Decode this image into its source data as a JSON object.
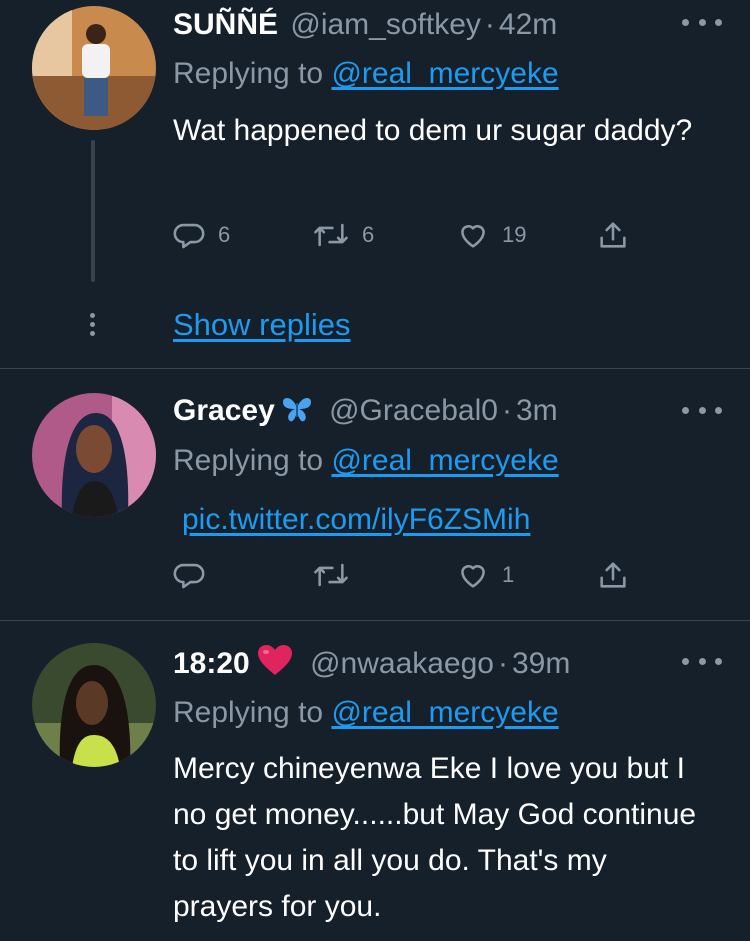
{
  "tweets": [
    {
      "name": "SUÑÑÉ",
      "handle": "@iam_softkey",
      "separator": "·",
      "time": "42m",
      "replying_prefix": "Replying to",
      "replying_to": "@real_mercyeke",
      "text": "Wat happened to dem ur sugar daddy?",
      "counts": {
        "reply": "6",
        "retweet": "6",
        "like": "19"
      }
    },
    {
      "name": "Gracey",
      "emoji": "butterfly",
      "handle": "@Gracebal0",
      "separator": "·",
      "time": "3m",
      "replying_prefix": "Replying to",
      "replying_to": "@real_mercyeke",
      "link": "pic.twitter.com/ilyF6ZSMih",
      "counts": {
        "reply": "",
        "retweet": "",
        "like": "1"
      }
    },
    {
      "name": "18:20",
      "emoji": "red-heart",
      "handle": "@nwaakaego",
      "separator": "·",
      "time": "39m",
      "replying_prefix": "Replying to",
      "replying_to": "@real_mercyeke",
      "text": "Mercy chineyenwa Eke I love you but I no get money......but May God continue to lift you in all you do. That's my prayers for you."
    }
  ],
  "thread": {
    "show_replies": "Show replies"
  },
  "colors": {
    "background": "#15202b",
    "secondary_text": "#8b98a5",
    "link": "#1d9bf0",
    "divider": "#38444d",
    "heart": "#e0245e",
    "butterfly": "#4aa3f0"
  },
  "icons": [
    "reply-icon",
    "retweet-icon",
    "like-icon",
    "share-icon",
    "more-options-icon"
  ]
}
